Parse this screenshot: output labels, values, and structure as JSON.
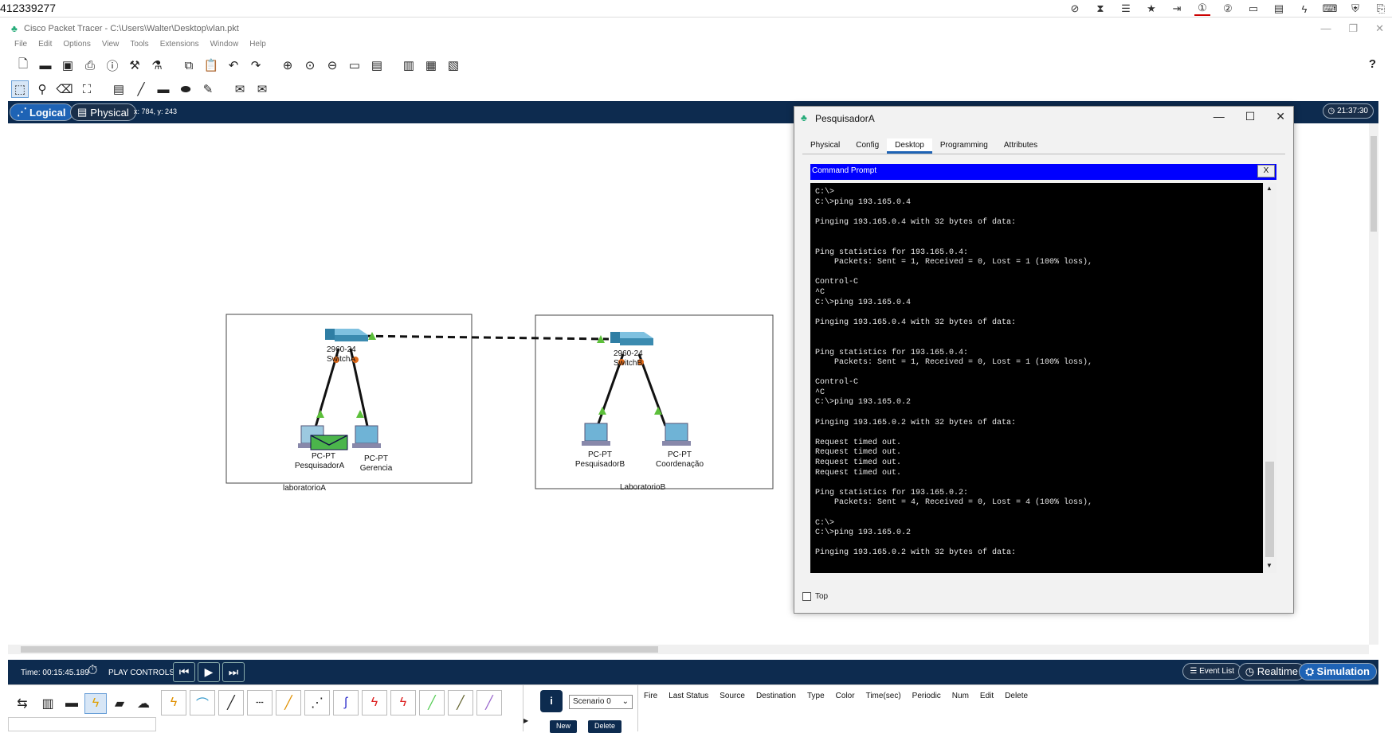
{
  "top_number": "412339277",
  "window": {
    "title": "Cisco Packet Tracer - C:\\Users\\Walter\\Desktop\\vlan.pkt",
    "controls": [
      "—",
      "❐",
      "✕"
    ]
  },
  "menu": [
    "File",
    "Edit",
    "Options",
    "View",
    "Tools",
    "Extensions",
    "Window",
    "Help"
  ],
  "help_label": "?",
  "logical_bar": {
    "logical": "Logical",
    "physical": "Physical",
    "coords": "x: 784, y: 243",
    "clock": "21:37:30"
  },
  "network": {
    "boxes": [
      {
        "label": "laboratorioA"
      },
      {
        "label": "LaboratorioB"
      }
    ],
    "switches": [
      {
        "model": "2960-24",
        "name": "SwitchA"
      },
      {
        "model": "2960-24",
        "name": "SwitchB"
      }
    ],
    "pcs": [
      {
        "type": "PC-PT",
        "name": "PesquisadorA"
      },
      {
        "type": "PC-PT",
        "name": "Gerencia"
      },
      {
        "type": "PC-PT",
        "name": "PesquisadorB"
      },
      {
        "type": "PC-PT",
        "name": "Coordenação"
      }
    ]
  },
  "dialog": {
    "title": "PesquisadorA",
    "controls": [
      "—",
      "☐",
      "✕"
    ],
    "tabs": [
      "Physical",
      "Config",
      "Desktop",
      "Programming",
      "Attributes"
    ],
    "active_tab": "Desktop",
    "cmd_title": "Command Prompt",
    "cmd_close": "X",
    "terminal_text": "C:\\>\nC:\\>ping 193.165.0.4\n\nPinging 193.165.0.4 with 32 bytes of data:\n\n\nPing statistics for 193.165.0.4:\n    Packets: Sent = 1, Received = 0, Lost = 1 (100% loss),\n\nControl-C\n^C\nC:\\>ping 193.165.0.4\n\nPinging 193.165.0.4 with 32 bytes of data:\n\n\nPing statistics for 193.165.0.4:\n    Packets: Sent = 1, Received = 0, Lost = 1 (100% loss),\n\nControl-C\n^C\nC:\\>ping 193.165.0.2\n\nPinging 193.165.0.2 with 32 bytes of data:\n\nRequest timed out.\nRequest timed out.\nRequest timed out.\nRequest timed out.\n\nPing statistics for 193.165.0.2:\n    Packets: Sent = 4, Received = 0, Lost = 4 (100% loss),\n\nC:\\>\nC:\\>ping 193.165.0.2\n\nPinging 193.165.0.2 with 32 bytes of data:",
    "top_checkbox": "Top"
  },
  "bottom": {
    "time": "Time: 00:15:45.189",
    "play_controls": "PLAY CONTROLS:",
    "event_list": "Event List",
    "realtime": "Realtime",
    "simulation": "Simulation",
    "scenario": "Scenario 0",
    "new": "New",
    "delete": "Delete",
    "pdu_columns": [
      "Fire",
      "Last Status",
      "Source",
      "Destination",
      "Type",
      "Color",
      "Time(sec)",
      "Periodic",
      "Num",
      "Edit",
      "Delete"
    ]
  },
  "colors": {
    "dark_bar": "#0d2b4f",
    "accent_blue": "#1e63b5",
    "cmd_header": "#0000ff",
    "switch": "#3b8bb0",
    "link_green": "#5cbf3a"
  }
}
